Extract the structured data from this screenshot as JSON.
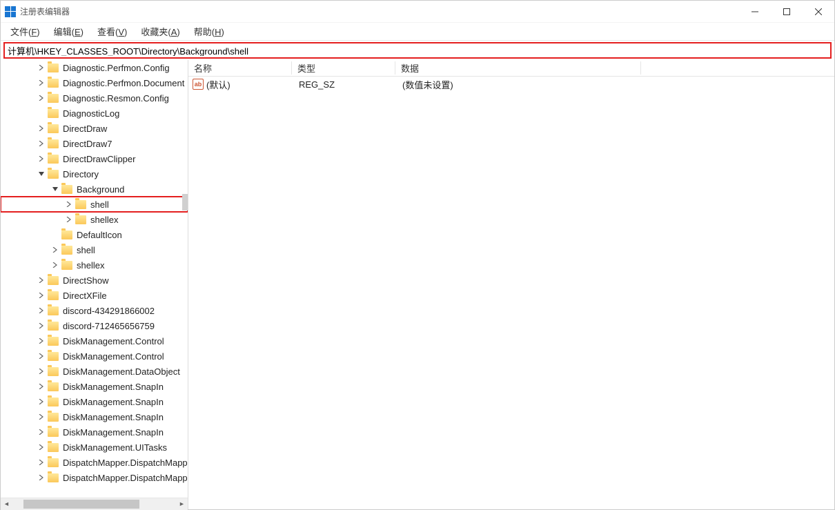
{
  "window": {
    "title": "注册表编辑器"
  },
  "menubar": {
    "file": "文件(F)",
    "edit": "编辑(E)",
    "view": "查看(V)",
    "favorites": "收藏夹(A)",
    "help": "帮助(H)"
  },
  "address": "计算机\\HKEY_CLASSES_ROOT\\Directory\\Background\\shell",
  "tree": [
    {
      "depth": 0,
      "exp": ">",
      "label": "Diagnostic.Perfmon.Config"
    },
    {
      "depth": 0,
      "exp": ">",
      "label": "Diagnostic.Perfmon.Document"
    },
    {
      "depth": 0,
      "exp": ">",
      "label": "Diagnostic.Resmon.Config"
    },
    {
      "depth": 0,
      "exp": "",
      "label": "DiagnosticLog"
    },
    {
      "depth": 0,
      "exp": ">",
      "label": "DirectDraw"
    },
    {
      "depth": 0,
      "exp": ">",
      "label": "DirectDraw7"
    },
    {
      "depth": 0,
      "exp": ">",
      "label": "DirectDrawClipper"
    },
    {
      "depth": 0,
      "exp": "v",
      "label": "Directory"
    },
    {
      "depth": 1,
      "exp": "v",
      "label": "Background"
    },
    {
      "depth": 2,
      "exp": ">",
      "label": "shell",
      "highlight": true
    },
    {
      "depth": 2,
      "exp": ">",
      "label": "shellex"
    },
    {
      "depth": 1,
      "exp": "",
      "label": "DefaultIcon"
    },
    {
      "depth": 1,
      "exp": ">",
      "label": "shell"
    },
    {
      "depth": 1,
      "exp": ">",
      "label": "shellex"
    },
    {
      "depth": 0,
      "exp": ">",
      "label": "DirectShow"
    },
    {
      "depth": 0,
      "exp": ">",
      "label": "DirectXFile"
    },
    {
      "depth": 0,
      "exp": ">",
      "label": "discord-434291866002"
    },
    {
      "depth": 0,
      "exp": ">",
      "label": "discord-712465656759"
    },
    {
      "depth": 0,
      "exp": ">",
      "label": "DiskManagement.Control"
    },
    {
      "depth": 0,
      "exp": ">",
      "label": "DiskManagement.Control"
    },
    {
      "depth": 0,
      "exp": ">",
      "label": "DiskManagement.DataObject"
    },
    {
      "depth": 0,
      "exp": ">",
      "label": "DiskManagement.SnapIn"
    },
    {
      "depth": 0,
      "exp": ">",
      "label": "DiskManagement.SnapIn"
    },
    {
      "depth": 0,
      "exp": ">",
      "label": "DiskManagement.SnapIn"
    },
    {
      "depth": 0,
      "exp": ">",
      "label": "DiskManagement.SnapIn"
    },
    {
      "depth": 0,
      "exp": ">",
      "label": "DiskManagement.UITasks"
    },
    {
      "depth": 0,
      "exp": ">",
      "label": "DispatchMapper.DispatchMapper"
    },
    {
      "depth": 0,
      "exp": ">",
      "label": "DispatchMapper.DispatchMapper"
    }
  ],
  "columns": {
    "name": "名称",
    "type": "类型",
    "data": "数据"
  },
  "values": [
    {
      "icon": "ab",
      "name": "(默认)",
      "type": "REG_SZ",
      "data": "(数值未设置)"
    }
  ]
}
